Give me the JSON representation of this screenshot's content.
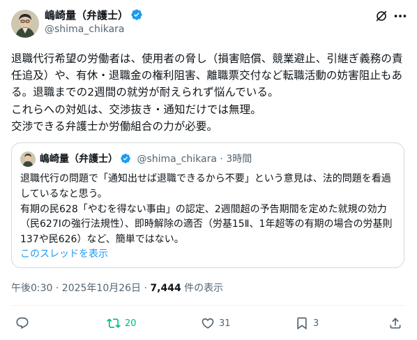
{
  "author": {
    "name": "嶋崎量（弁護士）",
    "handle": "@shima_chikara"
  },
  "post": {
    "text": "退職代行希望の労働者は、使用者の脅し（損害賠償、競業避止、引継ぎ義務の責任追及）や、有休・退職金の権利阻害、離職票交付など転職活動の妨害阻止もある。退職までの2週間の就労が耐えられず悩んでいる。\nこれらへの対処は、交渉抜き・通知だけでは無理。\n交渉できる弁護士か労働組合の力が必要。"
  },
  "quote": {
    "name": "嶋崎量（弁護士）",
    "meta": "@shima_chikara · 3時間",
    "text": "退職代行の問題で「通知出せば退職できるから不要」という意見は、法的問題を看過しているなと思う。\n有期の民628「やむを得ない事由」の認定、2週間超の予告期間を定めた就規の効力（民627Ⅰの強行法規性）、即時解除の適否（労基15Ⅱ、1年超等の有期の場合の労基則137や民626）など、簡単ではない。",
    "show_thread": "このスレッドを表示"
  },
  "timestamp": {
    "time": "午後0:30 · 2025年10月26日 · ",
    "views": "7,444",
    "views_suffix": " 件の表示"
  },
  "actions": {
    "reply_count": "",
    "repost_count": "20",
    "like_count": "31",
    "bookmark_count": "3"
  },
  "colors": {
    "accent": "#1d9bf0",
    "repost_active": "#00ba7c",
    "secondary_text": "#536471"
  }
}
